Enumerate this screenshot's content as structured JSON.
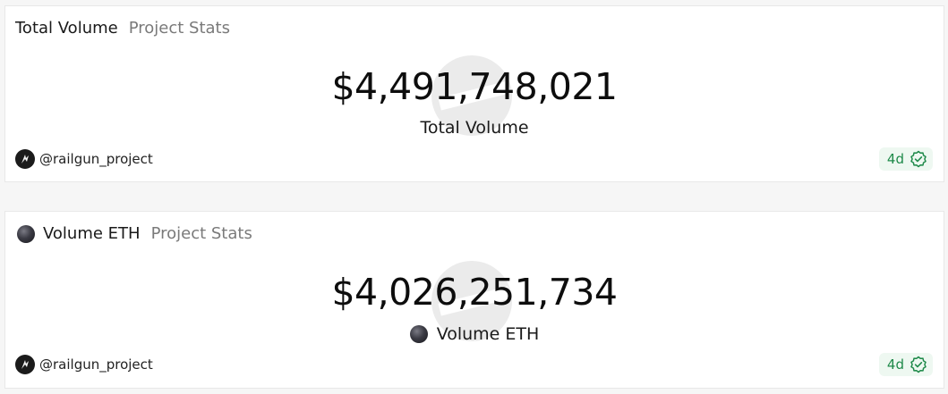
{
  "cards": [
    {
      "title": "Total Volume",
      "subtitle": "Project Stats",
      "value": "$4,491,748,021",
      "value_label": "Total Volume",
      "author": "@railgun_project",
      "age": "4d"
    },
    {
      "title": "Volume ETH",
      "subtitle": "Project Stats",
      "value": "$4,026,251,734",
      "value_label": "Volume ETH",
      "author": "@railgun_project",
      "age": "4d"
    }
  ],
  "colors": {
    "badge_text": "#1f8a4a",
    "badge_background": "#eef8f1",
    "token_icon": "#2b2b33"
  },
  "icons": {
    "token": "eth-token-icon",
    "avatar": "railgun-avatar",
    "verified": "verified-check-icon",
    "watermark": "watermark-logo"
  }
}
